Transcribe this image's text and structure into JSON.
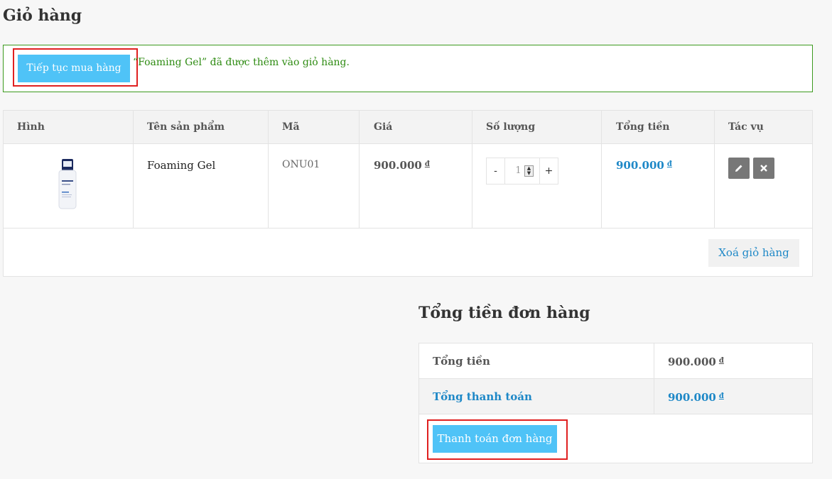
{
  "page": {
    "title": "Giỏ hàng"
  },
  "notice": {
    "continue_label": "Tiếp tục mua hàng",
    "message": "“Foaming Gel” đã được thêm vào giỏ hàng."
  },
  "cart": {
    "headers": [
      "Hình",
      "Tên sản phẩm",
      "Mã",
      "Giá",
      "Số lượng",
      "Tổng tiền",
      "Tác vụ"
    ],
    "items": [
      {
        "name": "Foaming Gel",
        "sku": "ONU01",
        "price": "900.000",
        "quantity": "1",
        "total": "900.000",
        "currency": "đ",
        "product_image_icon": "product-bottle-icon"
      }
    ],
    "qty_minus": "-",
    "qty_plus": "+",
    "edit_icon": "pencil-icon",
    "remove_icon": "close-icon",
    "clear_label": "Xoá giỏ hàng"
  },
  "totals": {
    "title": "Tổng tiền đơn hàng",
    "subtotal_label": "Tổng tiền",
    "subtotal_value": "900.000",
    "grand_label": "Tổng thanh toán",
    "grand_value": "900.000",
    "currency": "đ",
    "checkout_label": "Thanh toán đơn hàng"
  },
  "colors": {
    "accent": "#4fc3f7",
    "link": "#1e88c7",
    "notice_border": "#3c9a1e",
    "highlight": "#e02020"
  }
}
